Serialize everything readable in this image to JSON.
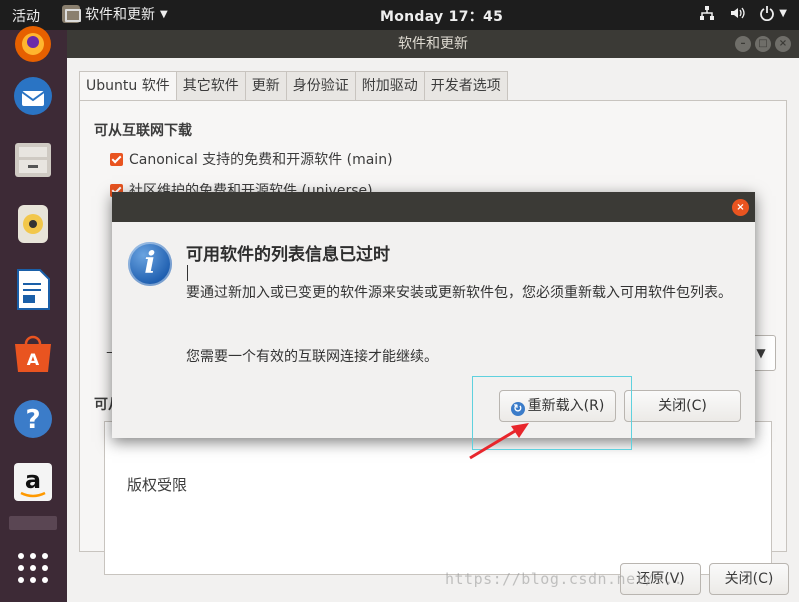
{
  "topbar": {
    "activities": "活动",
    "app_name": "软件和更新",
    "clock": "Monday 17：45"
  },
  "dock": {
    "items": [
      "firefox-icon",
      "thunderbird-icon",
      "files-icon",
      "rhythmbox-icon",
      "libreoffice-writer-icon",
      "software-center-icon",
      "help-icon",
      "amazon-icon",
      "apps-grid-icon"
    ]
  },
  "window": {
    "title": "软件和更新",
    "tabs": [
      "Ubuntu 软件",
      "其它软件",
      "更新",
      "身份验证",
      "附加驱动",
      "开发者选项"
    ],
    "download_section": "可从互联网下载",
    "sources": [
      "Canonical 支持的免费和开源软件 (main)",
      "社区维护的免费和开源软件 (universe)"
    ],
    "partial_label_left": "下",
    "cdrom_section_partial": "可从",
    "copyright": "版权受限",
    "revert_button": "还原(V)",
    "close_button": "关闭(C)"
  },
  "dialog": {
    "heading": "可用软件的列表信息已过时",
    "body": "要通过新加入或已变更的软件源来安装或更新软件包，您必须重新载入可用软件包列表。",
    "note": "您需要一个有效的互联网连接才能继续。",
    "reload_button": "重新载入(R)",
    "close_button": "关闭(C)"
  },
  "watermark": "https://blog.csdn.net/..."
}
